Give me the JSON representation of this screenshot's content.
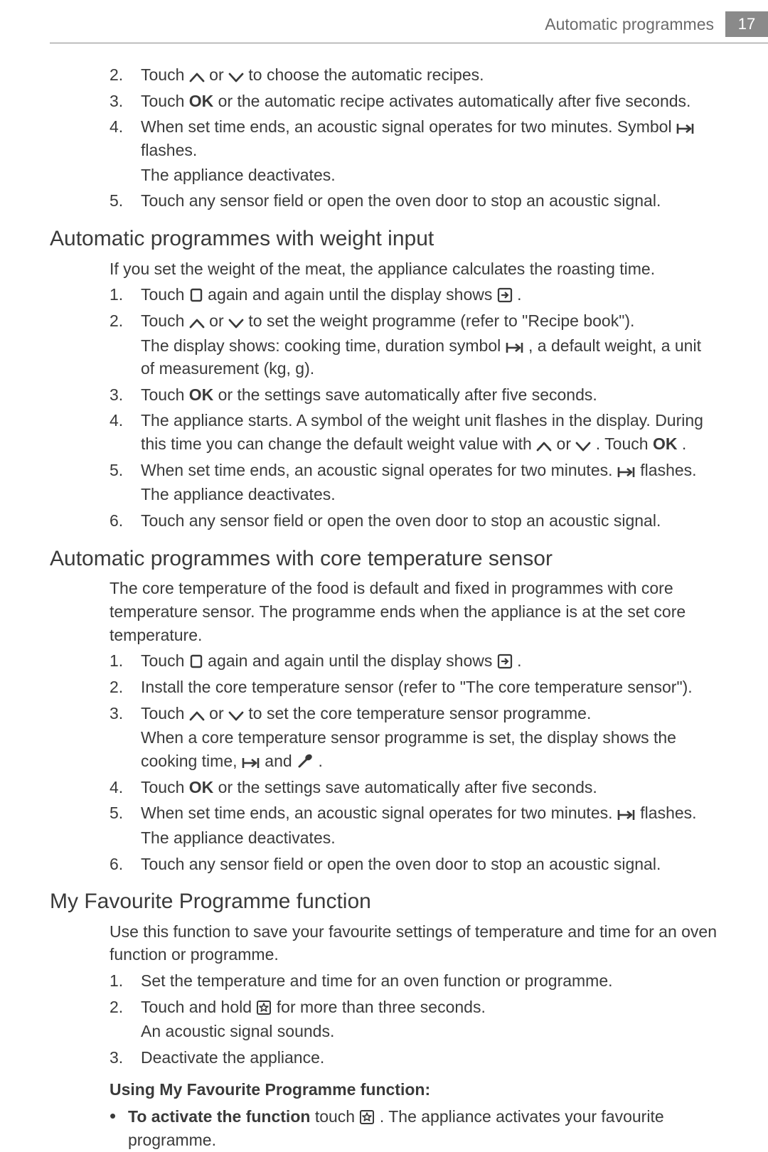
{
  "header": {
    "title": "Automatic programmes",
    "page_number": "17"
  },
  "top_list": [
    {
      "n": "2.",
      "parts": [
        "Touch ",
        "ICON_UP",
        " or ",
        "ICON_DOWN",
        " to choose the automatic recipes."
      ]
    },
    {
      "n": "3.",
      "parts": [
        "Touch ",
        "OK",
        " or the automatic recipe activates automatically after five seconds."
      ]
    },
    {
      "n": "4.",
      "parts": [
        "When set time ends, an acoustic signal operates for two minutes. Symbol ",
        "ICON_ARROW_END",
        " flashes."
      ],
      "tail": "The appliance deactivates."
    },
    {
      "n": "5.",
      "parts": [
        "Touch any sensor field or open the oven door to stop an acoustic signal."
      ]
    }
  ],
  "section_weight": {
    "heading": "Automatic programmes with weight input",
    "intro": "If you set the weight of the meat, the appliance calculates the roasting time.",
    "list": [
      {
        "n": "1.",
        "parts": [
          "Touch ",
          "ICON_RECT",
          " again and again until the display shows ",
          "ICON_BOX_ARROW",
          " ."
        ]
      },
      {
        "n": "2.",
        "parts": [
          "Touch ",
          "ICON_UP",
          " or ",
          "ICON_DOWN",
          " to set the weight programme (refer to \"Recipe book\")."
        ],
        "tail_parts": [
          "The display shows: cooking time, duration symbol ",
          "ICON_ARROW_END",
          " , a default weight, a unit of measurement (kg, g)."
        ]
      },
      {
        "n": "3.",
        "parts": [
          "Touch ",
          "OK",
          " or the settings save automatically after five seconds."
        ]
      },
      {
        "n": "4.",
        "parts": [
          "The appliance starts. A symbol of the weight unit flashes in the display. During this time you can change the default weight value with ",
          "ICON_UP",
          " or ",
          "ICON_DOWN",
          " . Touch ",
          "OK",
          " ."
        ]
      },
      {
        "n": "5.",
        "parts": [
          "When set time ends, an acoustic signal operates for two minutes. ",
          "ICON_ARROW_END",
          " flashes."
        ],
        "tail": "The appliance deactivates."
      },
      {
        "n": "6.",
        "parts": [
          "Touch any sensor field or open the oven door to stop an acoustic signal."
        ]
      }
    ]
  },
  "section_core": {
    "heading": "Automatic programmes with core temperature sensor",
    "intro": "The core temperature of the food is default and fixed in programmes with core temperature sensor. The programme ends when the appliance is at the set core temperature.",
    "list": [
      {
        "n": "1.",
        "parts": [
          "Touch ",
          "ICON_RECT",
          " again and again until the display shows ",
          "ICON_BOX_ARROW",
          " ."
        ]
      },
      {
        "n": "2.",
        "parts": [
          "Install the core temperature sensor (refer to \"The core temperature sensor\")."
        ]
      },
      {
        "n": "3.",
        "parts": [
          "Touch ",
          "ICON_UP",
          " or ",
          "ICON_DOWN",
          " to set the core temperature sensor programme."
        ],
        "tail_parts": [
          "When a core temperature sensor programme is set, the display shows the cooking time, ",
          "ICON_ARROW_END",
          " and ",
          "ICON_PROBE",
          " ."
        ]
      },
      {
        "n": "4.",
        "parts": [
          "Touch ",
          "OK",
          " or the settings save automatically after five seconds."
        ]
      },
      {
        "n": "5.",
        "parts": [
          "When set time ends, an acoustic signal operates for two minutes. ",
          "ICON_ARROW_END",
          " flashes."
        ],
        "tail": "The appliance deactivates."
      },
      {
        "n": "6.",
        "parts": [
          "Touch any sensor field or open the oven door to stop an acoustic signal."
        ]
      }
    ]
  },
  "section_fav": {
    "heading": "My Favourite Programme function",
    "intro": "Use this function to save your favourite settings of temperature and time for an oven function or programme.",
    "list": [
      {
        "n": "1.",
        "parts": [
          "Set the temperature and time for an oven function or programme."
        ]
      },
      {
        "n": "2.",
        "parts": [
          "Touch and hold ",
          "ICON_STAR_BOX",
          " for more than three seconds."
        ],
        "tail": "An acoustic signal sounds."
      },
      {
        "n": "3.",
        "parts": [
          "Deactivate the appliance."
        ]
      }
    ],
    "sub_heading": "Using My Favourite Programme function:",
    "bullet": {
      "lead_bold": "To activate the function",
      "parts": [
        " touch ",
        "ICON_STAR_BOX",
        " . The appliance activates your favourite programme."
      ]
    }
  },
  "icons": {
    "OK": "OK",
    "ICON_UP": "up-chevron",
    "ICON_DOWN": "down-chevron",
    "ICON_ARROW_END": "arrow-to-end",
    "ICON_RECT": "rect-outline",
    "ICON_BOX_ARROW": "box-arrow",
    "ICON_PROBE": "probe",
    "ICON_STAR_BOX": "star-box"
  }
}
